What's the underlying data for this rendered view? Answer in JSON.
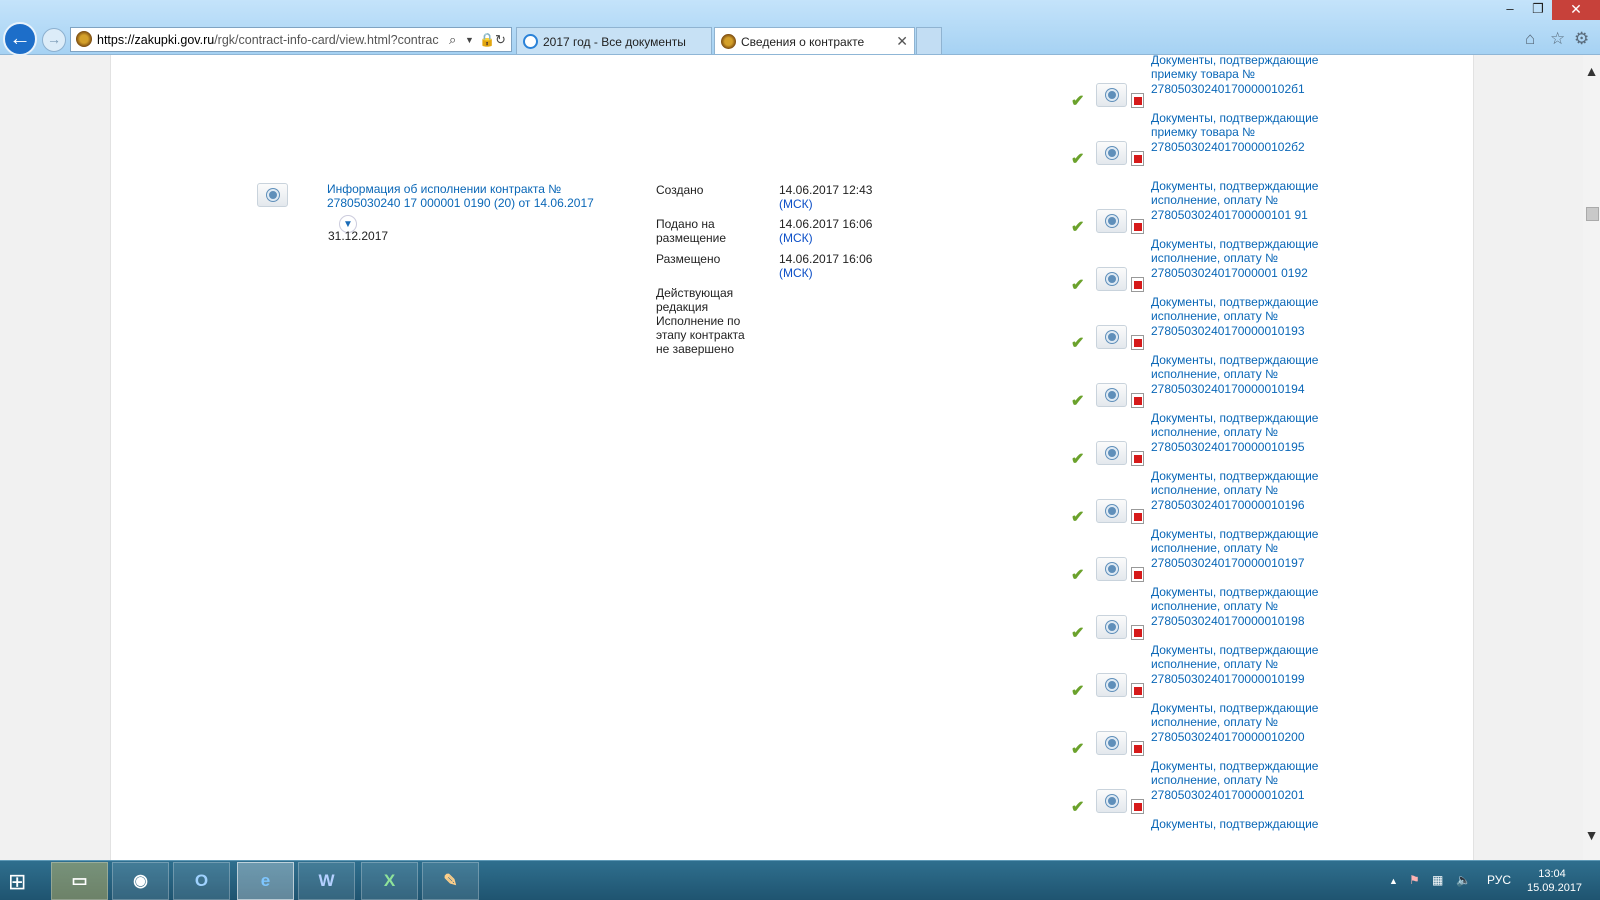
{
  "browser": {
    "url_main": "https://zakupki.gov.ru",
    "url_rest": "/rgk/contract-info-card/view.html?contrac",
    "tabs": [
      {
        "label": "2017 год - Все документы",
        "icon": "ie-icon"
      },
      {
        "label": "Сведения о контракте",
        "icon": "emblem-icon"
      }
    ],
    "window_controls": {
      "minimize": "–",
      "restore": "❐",
      "close": "✕"
    }
  },
  "record": {
    "title": "Информация об исполнении контракта № 27805030240 17 000001 0190 (20) от 14.06.2017",
    "date": "31.12.2017",
    "fields": [
      {
        "label": "Создано",
        "value": "14.06.2017 12:43",
        "tz": "(МСК)"
      },
      {
        "label": "Подано на размещение",
        "value": "14.06.2017 16:06",
        "tz": "(МСК)"
      },
      {
        "label": "Размещено",
        "value": "14.06.2017 16:06",
        "tz": "(МСК)"
      }
    ],
    "status": "Действующая редакция Исполнение по этапу контракта не завершено"
  },
  "documents": [
    {
      "text": "Документы, подтверждающие приемку товара № 278050302401700000102б1"
    },
    {
      "text": "Документы, подтверждающие приемку товара № 278050302401700000102б2"
    },
    {
      "text": "Документы, подтверждающие исполнение, оплату № 278050302401700000101 91"
    },
    {
      "text": "Документы, подтверждающие исполнение, оплату № 2780503024017000001 0192"
    },
    {
      "text": "Документы, подтверждающие исполнение, оплату № 27805030240170000010193"
    },
    {
      "text": "Документы, подтверждающие исполнение, оплату № 27805030240170000010194"
    },
    {
      "text": "Документы, подтверждающие исполнение, оплату № 27805030240170000010195"
    },
    {
      "text": "Документы, подтверждающие исполнение, оплату № 27805030240170000010196"
    },
    {
      "text": "Документы, подтверждающие исполнение, оплату № 27805030240170000010197"
    },
    {
      "text": "Документы, подтверждающие исполнение, оплату № 27805030240170000010198"
    },
    {
      "text": "Документы, подтверждающие исполнение, оплату № 27805030240170000010199"
    },
    {
      "text": "Документы, подтверждающие исполнение, оплату № 27805030240170000010200"
    },
    {
      "text": "Документы, подтверждающие исполнение, оплату № 27805030240170000010201"
    },
    {
      "text": "Документы, подтверждающие"
    }
  ],
  "taskbar": {
    "apps": [
      "file-explorer",
      "chrome",
      "outlook",
      "internet-explorer",
      "word",
      "excel",
      "paint"
    ],
    "language": "РУС",
    "time": "13:04",
    "date": "15.09.2017"
  }
}
